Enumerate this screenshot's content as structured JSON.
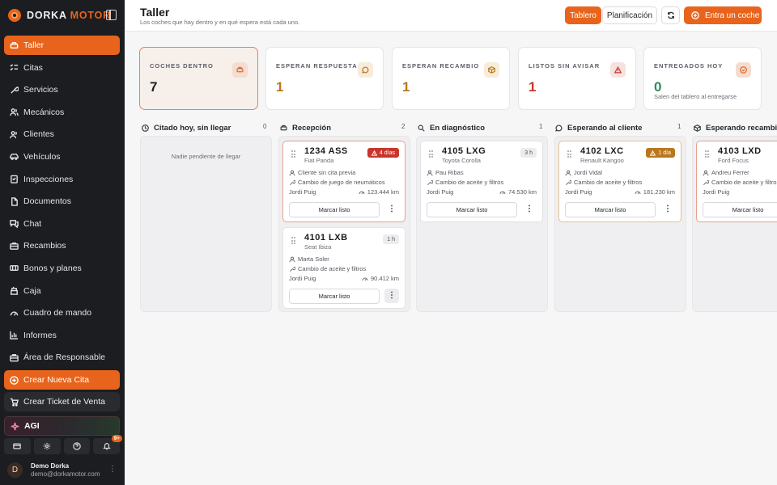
{
  "brand": {
    "name_part1": "DORKA",
    "name_part2": "MOTOR"
  },
  "sidebar": {
    "items": [
      {
        "label": "Taller"
      },
      {
        "label": "Citas"
      },
      {
        "label": "Servicios"
      },
      {
        "label": "Mecánicos"
      },
      {
        "label": "Clientes"
      },
      {
        "label": "Vehículos"
      },
      {
        "label": "Inspecciones"
      },
      {
        "label": "Documentos"
      },
      {
        "label": "Chat"
      },
      {
        "label": "Recambios"
      },
      {
        "label": "Bonos y planes"
      },
      {
        "label": "Caja"
      },
      {
        "label": "Cuadro de mando"
      },
      {
        "label": "Informes"
      },
      {
        "label": "Área de Responsable"
      }
    ],
    "new_appointment": "Crear Nueva Cita",
    "new_ticket": "Crear Ticket de Venta",
    "agi": "AGI",
    "notification_count": "9+",
    "user": {
      "initial": "D",
      "name": "Demo Dorka",
      "email": "demo@dorkamotor.com"
    }
  },
  "header": {
    "title": "Taller",
    "subtitle": "Los coches que hay dentro y en qué espera está cada uno.",
    "view_board": "Tablero",
    "view_planning": "Planificación",
    "primary_action": "Entra un coche"
  },
  "stats": [
    {
      "label": "COCHES DENTRO",
      "value": "7",
      "note": ""
    },
    {
      "label": "ESPERAN RESPUESTA",
      "value": "1",
      "note": ""
    },
    {
      "label": "ESPERAN RECAMBIO",
      "value": "1",
      "note": ""
    },
    {
      "label": "LISTOS SIN AVISAR",
      "value": "1",
      "note": ""
    },
    {
      "label": "ENTREGADOS HOY",
      "value": "0",
      "note": "Salen del tablero al entregarse"
    }
  ],
  "columns": [
    {
      "title": "Citado hoy, sin llegar",
      "count": "0",
      "empty": "Nadie pendiente de llegar"
    },
    {
      "title": "Recepción",
      "count": "2"
    },
    {
      "title": "En diagnóstico",
      "count": "1"
    },
    {
      "title": "Esperando al cliente",
      "count": "1"
    },
    {
      "title": "Esperando recambio",
      "count": ""
    }
  ],
  "cards": {
    "c1": {
      "plate": "1234 ASS",
      "model": "Fiat Panda",
      "badge": "4 días",
      "person": "Cliente sin cita previa",
      "service": "Cambio de juego de neumáticos",
      "mechanic": "Jordi Puig",
      "km": "123.444 km",
      "action": "Marcar listo"
    },
    "c2": {
      "plate": "4101 LXB",
      "model": "Seat Ibiza",
      "badge": "1 h",
      "person": "Marta Soler",
      "service": "Cambio de aceite y filtros",
      "mechanic": "Jordi Puig",
      "km": "90.412 km",
      "action": "Marcar listo"
    },
    "c3": {
      "plate": "4105 LXG",
      "model": "Toyota Corolla",
      "badge": "3 h",
      "person": "Pau Ribas",
      "service": "Cambio de aceite y filtros",
      "mechanic": "Jordi Puig",
      "km": "74.530 km",
      "action": "Marcar listo"
    },
    "c4": {
      "plate": "4102 LXC",
      "model": "Renault Kangoo",
      "badge": "1 día",
      "person": "Jordi Vidal",
      "service": "Cambio de aceite y filtros",
      "mechanic": "Jordi Puig",
      "km": "181.230 km",
      "action": "Marcar listo"
    },
    "c5": {
      "plate": "4103 LXD",
      "model": "Ford Focus",
      "badge": "",
      "person": "Andreu Ferrer",
      "service": "Cambio de aceite y filtros",
      "mechanic": "Jordi Puig",
      "km": "",
      "action": "Marcar listo"
    }
  },
  "colors": {
    "accent": "#e8641c",
    "danger": "#c9352b",
    "warning": "#b9781d",
    "success": "#2e8b57",
    "sidebar_bg": "#1c1d20"
  },
  "icons": {
    "nav": [
      "car-icon",
      "calendar-list-icon",
      "wrench-icon",
      "mechanics-icon",
      "clients-icon",
      "vehicle-icon",
      "inspection-icon",
      "document-icon",
      "chat-icon",
      "parts-icon",
      "bonus-icon",
      "cash-register-icon",
      "dashboard-gauge-icon",
      "reports-icon",
      "manager-area-icon"
    ]
  }
}
